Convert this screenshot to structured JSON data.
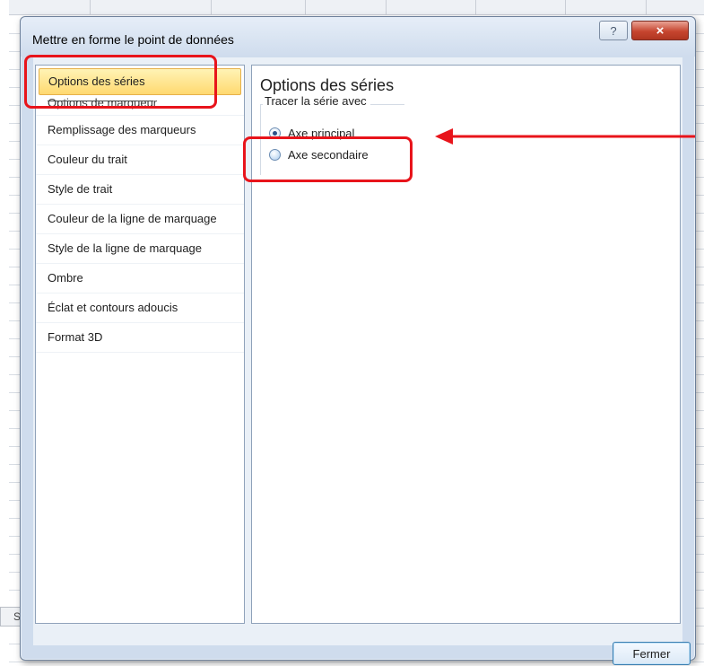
{
  "dialog": {
    "title": "Mettre en forme le point de données",
    "help_icon": "?",
    "close_icon": "×"
  },
  "nav": {
    "items": [
      {
        "label": "Options des séries",
        "selected": true
      },
      {
        "label": "Options de marqueur",
        "selected": false
      },
      {
        "label": "Remplissage des marqueurs",
        "selected": false
      },
      {
        "label": "Couleur du trait",
        "selected": false
      },
      {
        "label": "Style de trait",
        "selected": false
      },
      {
        "label": "Couleur de la ligne de marquage",
        "selected": false
      },
      {
        "label": "Style de la ligne de marquage",
        "selected": false
      },
      {
        "label": "Ombre",
        "selected": false
      },
      {
        "label": "Éclat et contours adoucis",
        "selected": false
      },
      {
        "label": "Format 3D",
        "selected": false
      }
    ]
  },
  "content": {
    "title": "Options des séries",
    "group_label": "Tracer la série avec",
    "radios": [
      {
        "label": "Axe principal",
        "checked": true
      },
      {
        "label": "Axe secondaire",
        "checked": false
      }
    ]
  },
  "footer": {
    "close_label": "Fermer"
  },
  "sheet": {
    "tab_label": "S"
  },
  "colors": {
    "annotation": "#e8141b",
    "selection": "#ffd970",
    "dialog_frame": "#cfdced"
  },
  "icons": {
    "help": "question-icon",
    "close": "close-icon",
    "annotation_arrow": "arrow-left-icon"
  }
}
